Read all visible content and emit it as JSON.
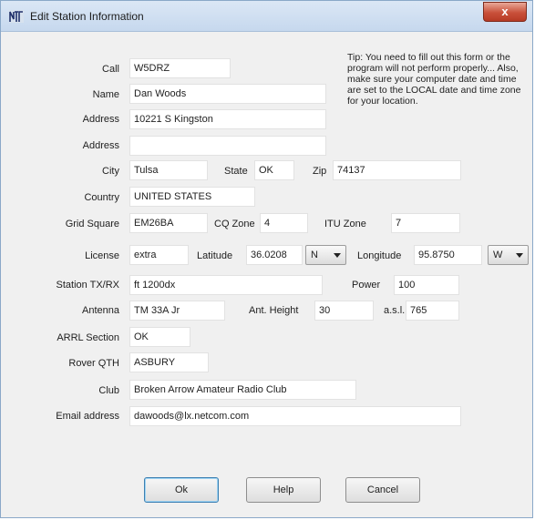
{
  "window": {
    "title": "Edit Station Information",
    "close_label": "x",
    "app_icon": "station-app-icon"
  },
  "tip": "Tip: You need to fill out this form or the program will not perform properly... Also, make sure your computer date and time are set to the LOCAL date and time zone for your location.",
  "labels": {
    "call": "Call",
    "name": "Name",
    "address1": "Address",
    "address2": "Address",
    "city": "City",
    "state": "State",
    "zip": "Zip",
    "country": "Country",
    "grid_square": "Grid Square",
    "cq_zone": "CQ Zone",
    "itu_zone": "ITU Zone",
    "license": "License",
    "latitude": "Latitude",
    "longitude": "Longitude",
    "station_txrx": "Station TX/RX",
    "power": "Power",
    "antenna": "Antenna",
    "ant_height": "Ant. Height",
    "asl": "a.s.l.",
    "arrl_section": "ARRL Section",
    "rover_qth": "Rover QTH",
    "club": "Club",
    "email": "Email address"
  },
  "values": {
    "call": "W5DRZ",
    "name": "Dan Woods",
    "address1": "10221 S Kingston",
    "address2": "",
    "city": "Tulsa",
    "state": "OK",
    "zip": "74137",
    "country": "UNITED STATES",
    "grid_square": "EM26BA",
    "cq_zone": "4",
    "itu_zone": "7",
    "license": "extra",
    "latitude": "36.0208",
    "latitude_dir": "N",
    "longitude": "95.8750",
    "longitude_dir": "W",
    "station_txrx": "ft 1200dx",
    "power": "100",
    "antenna": "TM 33A Jr",
    "ant_height": "30",
    "asl": "765",
    "arrl_section": "OK",
    "rover_qth": "ASBURY",
    "club": "Broken Arrow Amateur Radio Club",
    "email": "dawoods@lx.netcom.com"
  },
  "buttons": {
    "ok": "Ok",
    "help": "Help",
    "cancel": "Cancel"
  }
}
